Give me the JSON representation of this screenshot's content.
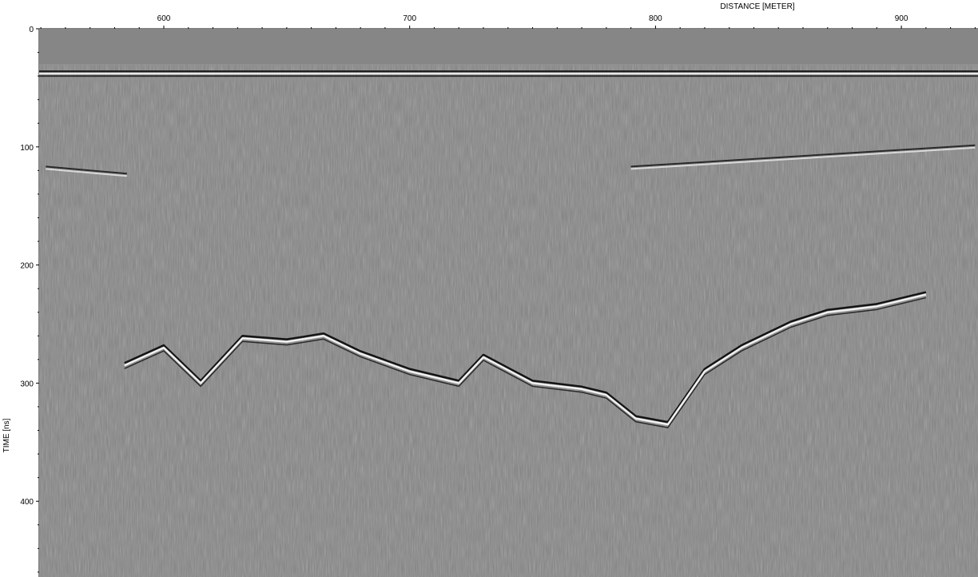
{
  "chart_data": {
    "type": "heatmap",
    "title": "",
    "xlabel": "DISTANCE [METER]",
    "ylabel": "TIME [ns]",
    "xlim": [
      549,
      932
    ],
    "ylim": [
      0,
      465
    ],
    "y_inverted": true,
    "x_axis_position": "top",
    "x_ticks": [
      600,
      700,
      800,
      900
    ],
    "y_ticks": [
      0,
      100,
      200,
      300,
      400
    ],
    "colormap": "grayscale",
    "background_color": "#808080",
    "description_layers": {
      "air_band": {
        "from_time": 0,
        "to_time": 30
      },
      "direct_wave": {
        "time": 38
      },
      "shallow_reflector_left": {
        "x": [
          552,
          585
        ],
        "time": [
          118,
          124
        ]
      },
      "shallow_reflector_right": {
        "x": [
          790,
          930
        ],
        "time": [
          118,
          100
        ]
      },
      "deep_reflector": {
        "x": [
          584,
          600,
          615,
          632,
          650,
          665,
          680,
          700,
          720,
          730,
          750,
          770,
          780,
          792,
          805,
          820,
          835,
          855,
          870,
          890,
          910
        ],
        "time": [
          285,
          270,
          300,
          262,
          265,
          260,
          275,
          290,
          300,
          278,
          300,
          305,
          310,
          330,
          335,
          290,
          270,
          250,
          240,
          235,
          225
        ]
      }
    }
  }
}
